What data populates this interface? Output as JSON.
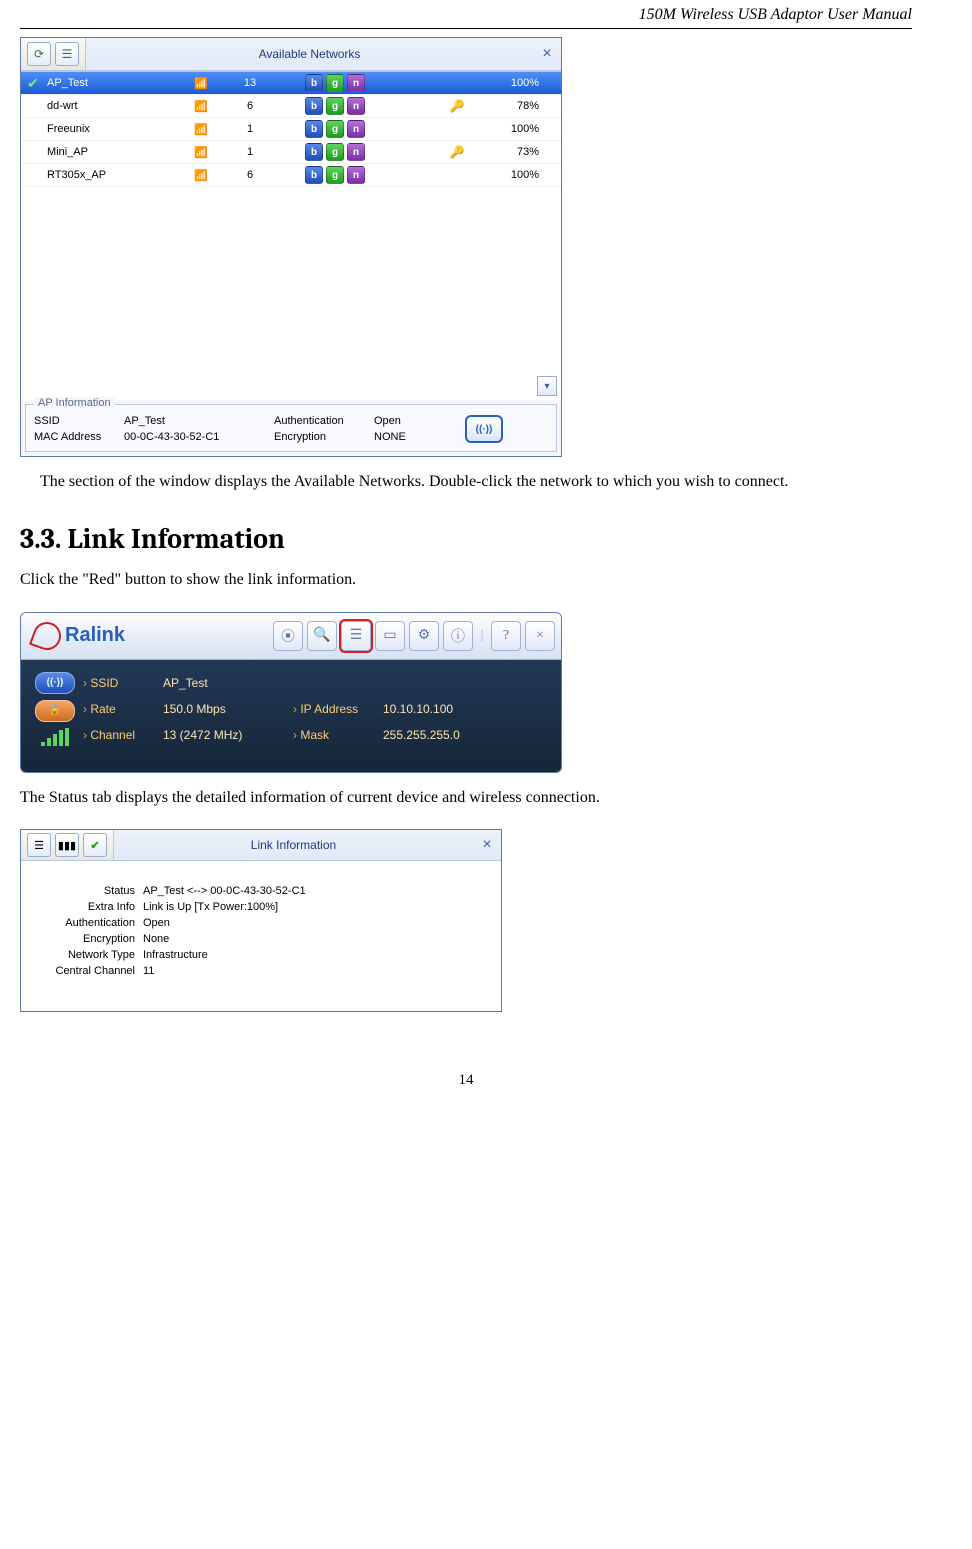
{
  "header": "150M Wireless USB Adaptor User Manual",
  "fig1": {
    "title": "Available Networks",
    "ap_info_legend": "AP Information",
    "labels": {
      "ssid": "SSID",
      "mac": "MAC Address",
      "auth": "Authentication",
      "enc": "Encryption"
    },
    "rows": [
      {
        "name": "AP_Test",
        "ch": "13",
        "sec": false,
        "pct": "100%",
        "selected": true
      },
      {
        "name": "dd-wrt",
        "ch": "6",
        "sec": true,
        "pct": "78%",
        "selected": false
      },
      {
        "name": "Freeunix",
        "ch": "1",
        "sec": false,
        "pct": "100%",
        "selected": false
      },
      {
        "name": "Mini_AP",
        "ch": "1",
        "sec": true,
        "pct": "73%",
        "selected": false
      },
      {
        "name": "RT305x_AP",
        "ch": "6",
        "sec": false,
        "pct": "100%",
        "selected": false
      }
    ],
    "info": {
      "ssid": "AP_Test",
      "mac": "00-0C-43-30-52-C1",
      "auth": "Open",
      "enc": "NONE"
    }
  },
  "para1": "The section of the window displays the Available Networks. Double-click the network to which you wish to connect.",
  "heading": "3.3. Link Information",
  "para2": "Click the \"Red\" button to show the link information.",
  "fig2": {
    "logo": "Ralink",
    "rows": {
      "ssid_l": "SSID",
      "ssid_v": "AP_Test",
      "rate_l": "Rate",
      "rate_v": "150.0 Mbps",
      "ip_l": "IP Address",
      "ip_v": "10.10.10.100",
      "ch_l": "Channel",
      "ch_v": "13 (2472 MHz)",
      "mask_l": "Mask",
      "mask_v": "255.255.255.0"
    }
  },
  "para3": "The Status tab displays the detailed information of current device and wireless connection.",
  "fig3": {
    "title": "Link Information",
    "rows": [
      {
        "l": "Status",
        "v": "AP_Test <--> 00-0C-43-30-52-C1"
      },
      {
        "l": "Extra Info",
        "v": "Link is Up [Tx Power:100%]"
      },
      {
        "l": "Authentication",
        "v": "Open"
      },
      {
        "l": "Encryption",
        "v": "None"
      },
      {
        "l": "Network Type",
        "v": "Infrastructure"
      },
      {
        "l": "Central Channel",
        "v": "11"
      }
    ]
  },
  "page_number": "14",
  "badges": {
    "b": "b",
    "g": "g",
    "n": "n"
  }
}
